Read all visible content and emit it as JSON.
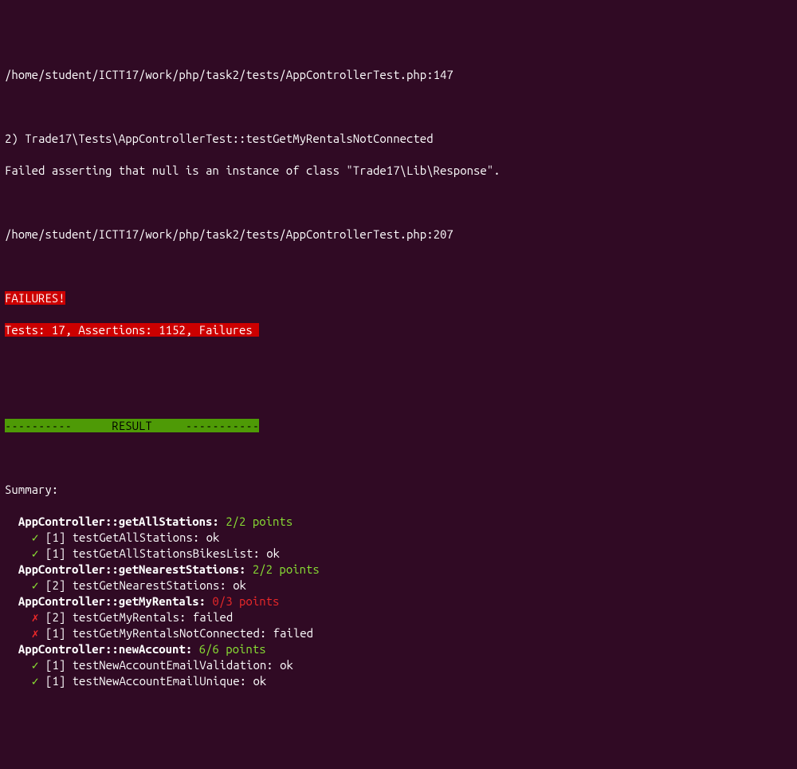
{
  "trace1": "/home/student/ICTT17/work/php/task2/tests/AppControllerTest.php:147",
  "failure_header": "2) Trade17\\Tests\\AppControllerTest::testGetMyRentalsNotConnected",
  "failure_msg": "Failed asserting that null is an instance of class \"Trade17\\Lib\\Response\".",
  "trace2": "/home/student/ICTT17/work/php/task2/tests/AppControllerTest.php:207",
  "fail_banner1": "FAILURES!",
  "fail_banner2": "Tests: 17, Assertions: 1152, Failures ",
  "result_banner": "----------      RESULT     -----------",
  "summary_label": "Summary:",
  "groups": [
    {
      "prefix": "  ",
      "class": "AppController::getAllStations:",
      "score": " 2/2 points",
      "score_class": "green-txt",
      "tests": [
        {
          "mark": "✓",
          "mark_class": "green-txt",
          "points": "[1]",
          "name": " testGetAllStations: ",
          "status": "ok"
        },
        {
          "mark": "✓",
          "mark_class": "green-txt",
          "points": "[1]",
          "name": " testGetAllStationsBikesList: ",
          "status": "ok"
        }
      ]
    },
    {
      "prefix": "  ",
      "class": "AppController::getNearestStations:",
      "score": " 2/2 points",
      "score_class": "green-txt",
      "tests": [
        {
          "mark": "✓",
          "mark_class": "green-txt",
          "points": "[2]",
          "name": " testGetNearestStations: ",
          "status": "ok"
        }
      ]
    },
    {
      "prefix": "  ",
      "class": "AppController::getMyRentals:",
      "score": " 0/3 points",
      "score_class": "red-txt",
      "tests": [
        {
          "mark": "✗",
          "mark_class": "red-txt",
          "points": "[2]",
          "name": " testGetMyRentals: ",
          "status": "failed"
        },
        {
          "mark": "✗",
          "mark_class": "red-txt",
          "points": "[1]",
          "name": " testGetMyRentalsNotConnected: ",
          "status": "failed"
        }
      ]
    },
    {
      "prefix": "  ",
      "class": "AppController::newAccount:",
      "score": " 6/6 points",
      "score_class": "green-txt",
      "tests": [
        {
          "mark": "✓",
          "mark_class": "green-txt",
          "points": "[1]",
          "name": " testNewAccountEmailValidation: ",
          "status": "ok"
        },
        {
          "mark": "✓",
          "mark_class": "green-txt",
          "points": "[1]",
          "name": " testNewAccountEmailUnique: ",
          "status": "ok"
        }
      ]
    }
  ]
}
